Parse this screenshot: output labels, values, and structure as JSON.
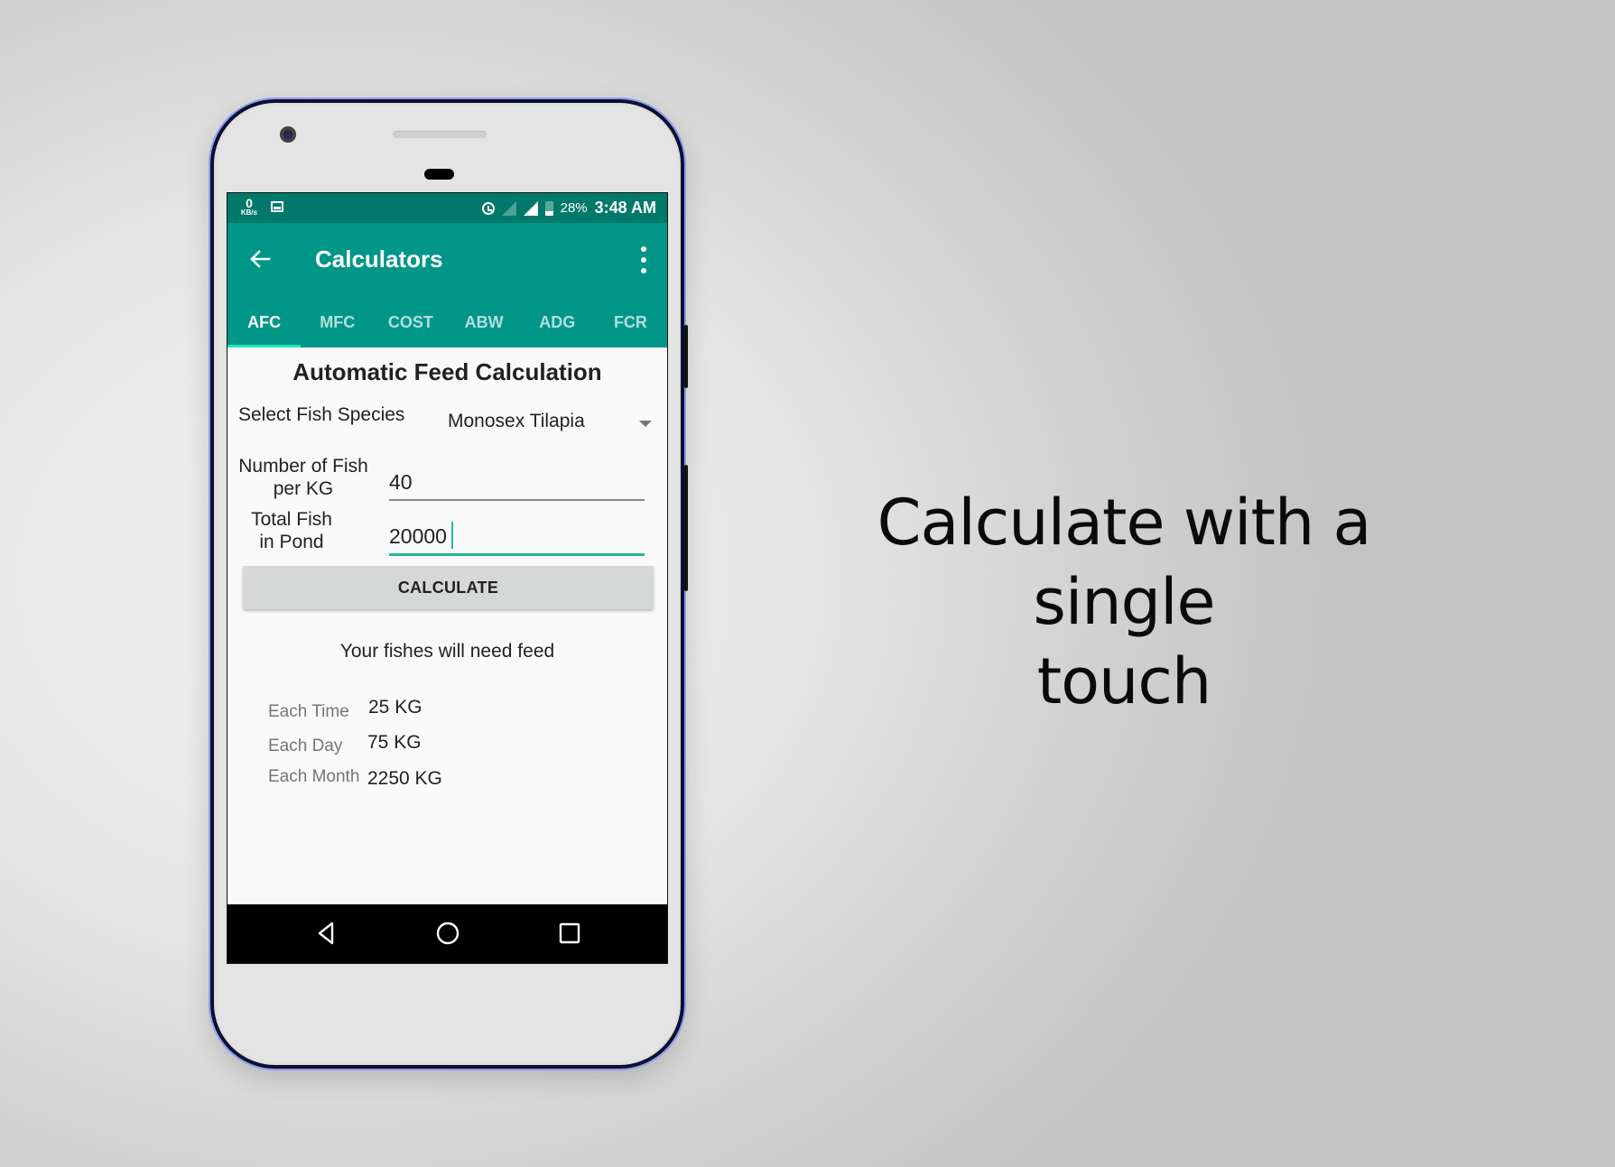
{
  "tagline": {
    "line1": "Calculate with a single",
    "line2": "touch"
  },
  "status_bar": {
    "net_speed_value": "0",
    "net_speed_unit": "KB/s",
    "icons": [
      "image-icon",
      "alarm-icon",
      "signal-empty-icon",
      "signal-full-icon",
      "battery-icon"
    ],
    "battery": "28%",
    "time": "3:48 AM"
  },
  "app_bar": {
    "title": "Calculators",
    "back_icon": "arrow-left-icon",
    "menu_icon": "more-vert-icon"
  },
  "tabs": [
    {
      "label": "AFC",
      "active": true
    },
    {
      "label": "MFC",
      "active": false
    },
    {
      "label": "COST",
      "active": false
    },
    {
      "label": "ABW",
      "active": false
    },
    {
      "label": "ADG",
      "active": false
    },
    {
      "label": "FCR",
      "active": false
    }
  ],
  "form": {
    "title": "Automatic Feed Calculation",
    "species_label": "Select Fish Species",
    "species_value": "Monosex Tilapia",
    "fish_per_kg_label_1": "Number of Fish",
    "fish_per_kg_label_2": "per KG",
    "fish_per_kg_value": "40",
    "total_fish_label_1": "Total Fish",
    "total_fish_label_2": "in Pond",
    "total_fish_value": "20000",
    "calculate_label": "CALCULATE"
  },
  "results": {
    "heading": "Your fishes will need feed",
    "rows": [
      {
        "label": "Each Time",
        "value": "25 KG"
      },
      {
        "label": "Each Day",
        "value": "75 KG"
      },
      {
        "label": "Each Month",
        "value": "2250 KG"
      }
    ]
  },
  "nav_bar": {
    "icons": [
      "back-triangle-icon",
      "home-circle-icon",
      "recents-square-icon"
    ]
  },
  "colors": {
    "primary": "#009688",
    "primary_dark": "#00796b",
    "accent": "#1de9b6",
    "background_light": "#f0f0f0",
    "background_dark": "#c4c4c4"
  }
}
